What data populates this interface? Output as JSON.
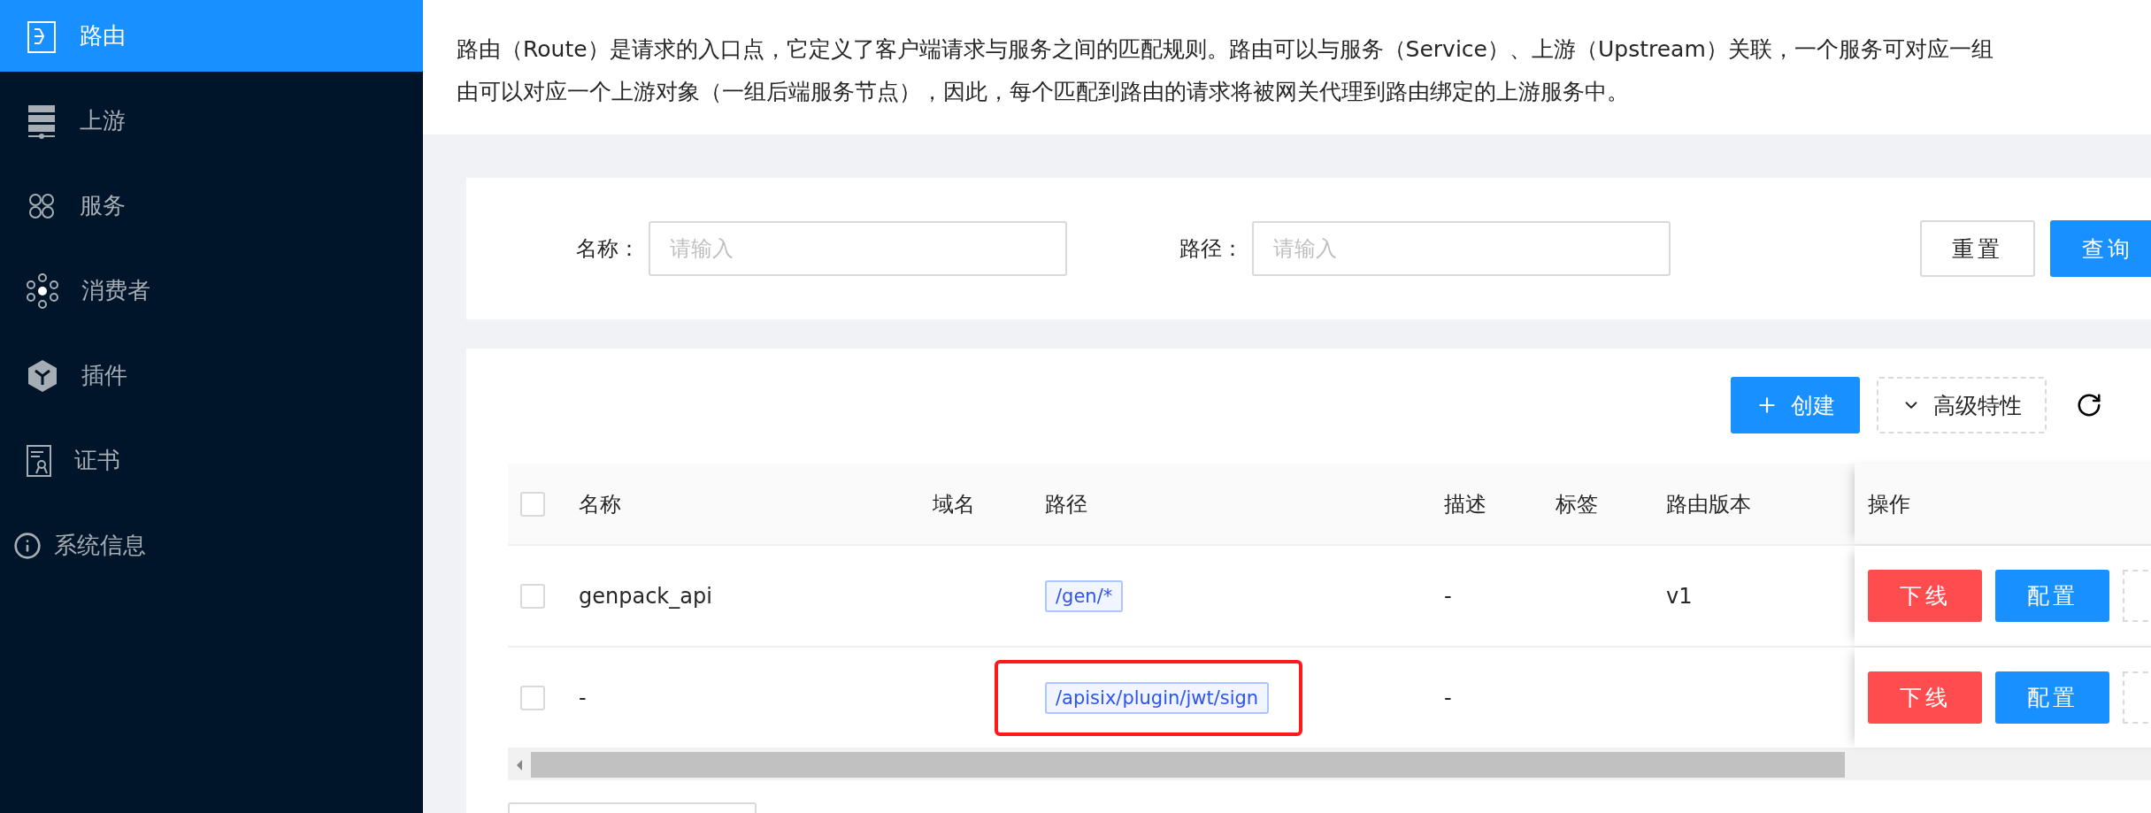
{
  "sidebar": {
    "items": [
      {
        "label": "路由",
        "kind": "route",
        "selected": true
      },
      {
        "label": "上游",
        "kind": "upstream",
        "selected": false
      },
      {
        "label": "服务",
        "kind": "service",
        "selected": false
      },
      {
        "label": "消费者",
        "kind": "consumer",
        "selected": false
      },
      {
        "label": "插件",
        "kind": "plugin",
        "selected": false
      },
      {
        "label": "证书",
        "kind": "cert",
        "selected": false
      },
      {
        "label": "系统信息",
        "kind": "info",
        "selected": false
      }
    ]
  },
  "description": [
    "路由（Route）是请求的入口点，它定义了客户端请求与服务之间的匹配规则。路由可以与服务（Service）、上游（Upstream）关联，一个服务可对应一组",
    "由可以对应一个上游对象（一组后端服务节点），因此，每个匹配到路由的请求将被网关代理到路由绑定的上游服务中。"
  ],
  "filters": [
    {
      "label": "名称：",
      "placeholder": "请输入"
    },
    {
      "label": "路径：",
      "placeholder": "请输入"
    }
  ],
  "filter_buttons": [
    {
      "label": "重置",
      "kind": "default"
    },
    {
      "label": "查询",
      "kind": "primary"
    }
  ],
  "toolbar": {
    "create": "创建",
    "advanced": "高级特性"
  },
  "table": {
    "header_checked": false,
    "columns": [
      "名称",
      "域名",
      "路径",
      "描述",
      "标签",
      "路由版本"
    ],
    "action_column": "操作",
    "rows": [
      {
        "checked": false,
        "name": "genpack_api",
        "path": "/gen/*",
        "path_highlighted": false,
        "description": "-",
        "version": "v1",
        "actions": [
          "下线",
          "配置"
        ]
      },
      {
        "checked": false,
        "name": "-",
        "path": "/apisix/plugin/jwt/sign",
        "path_highlighted": true,
        "description": "-",
        "actions": [
          "下线",
          "配置"
        ]
      }
    ]
  }
}
